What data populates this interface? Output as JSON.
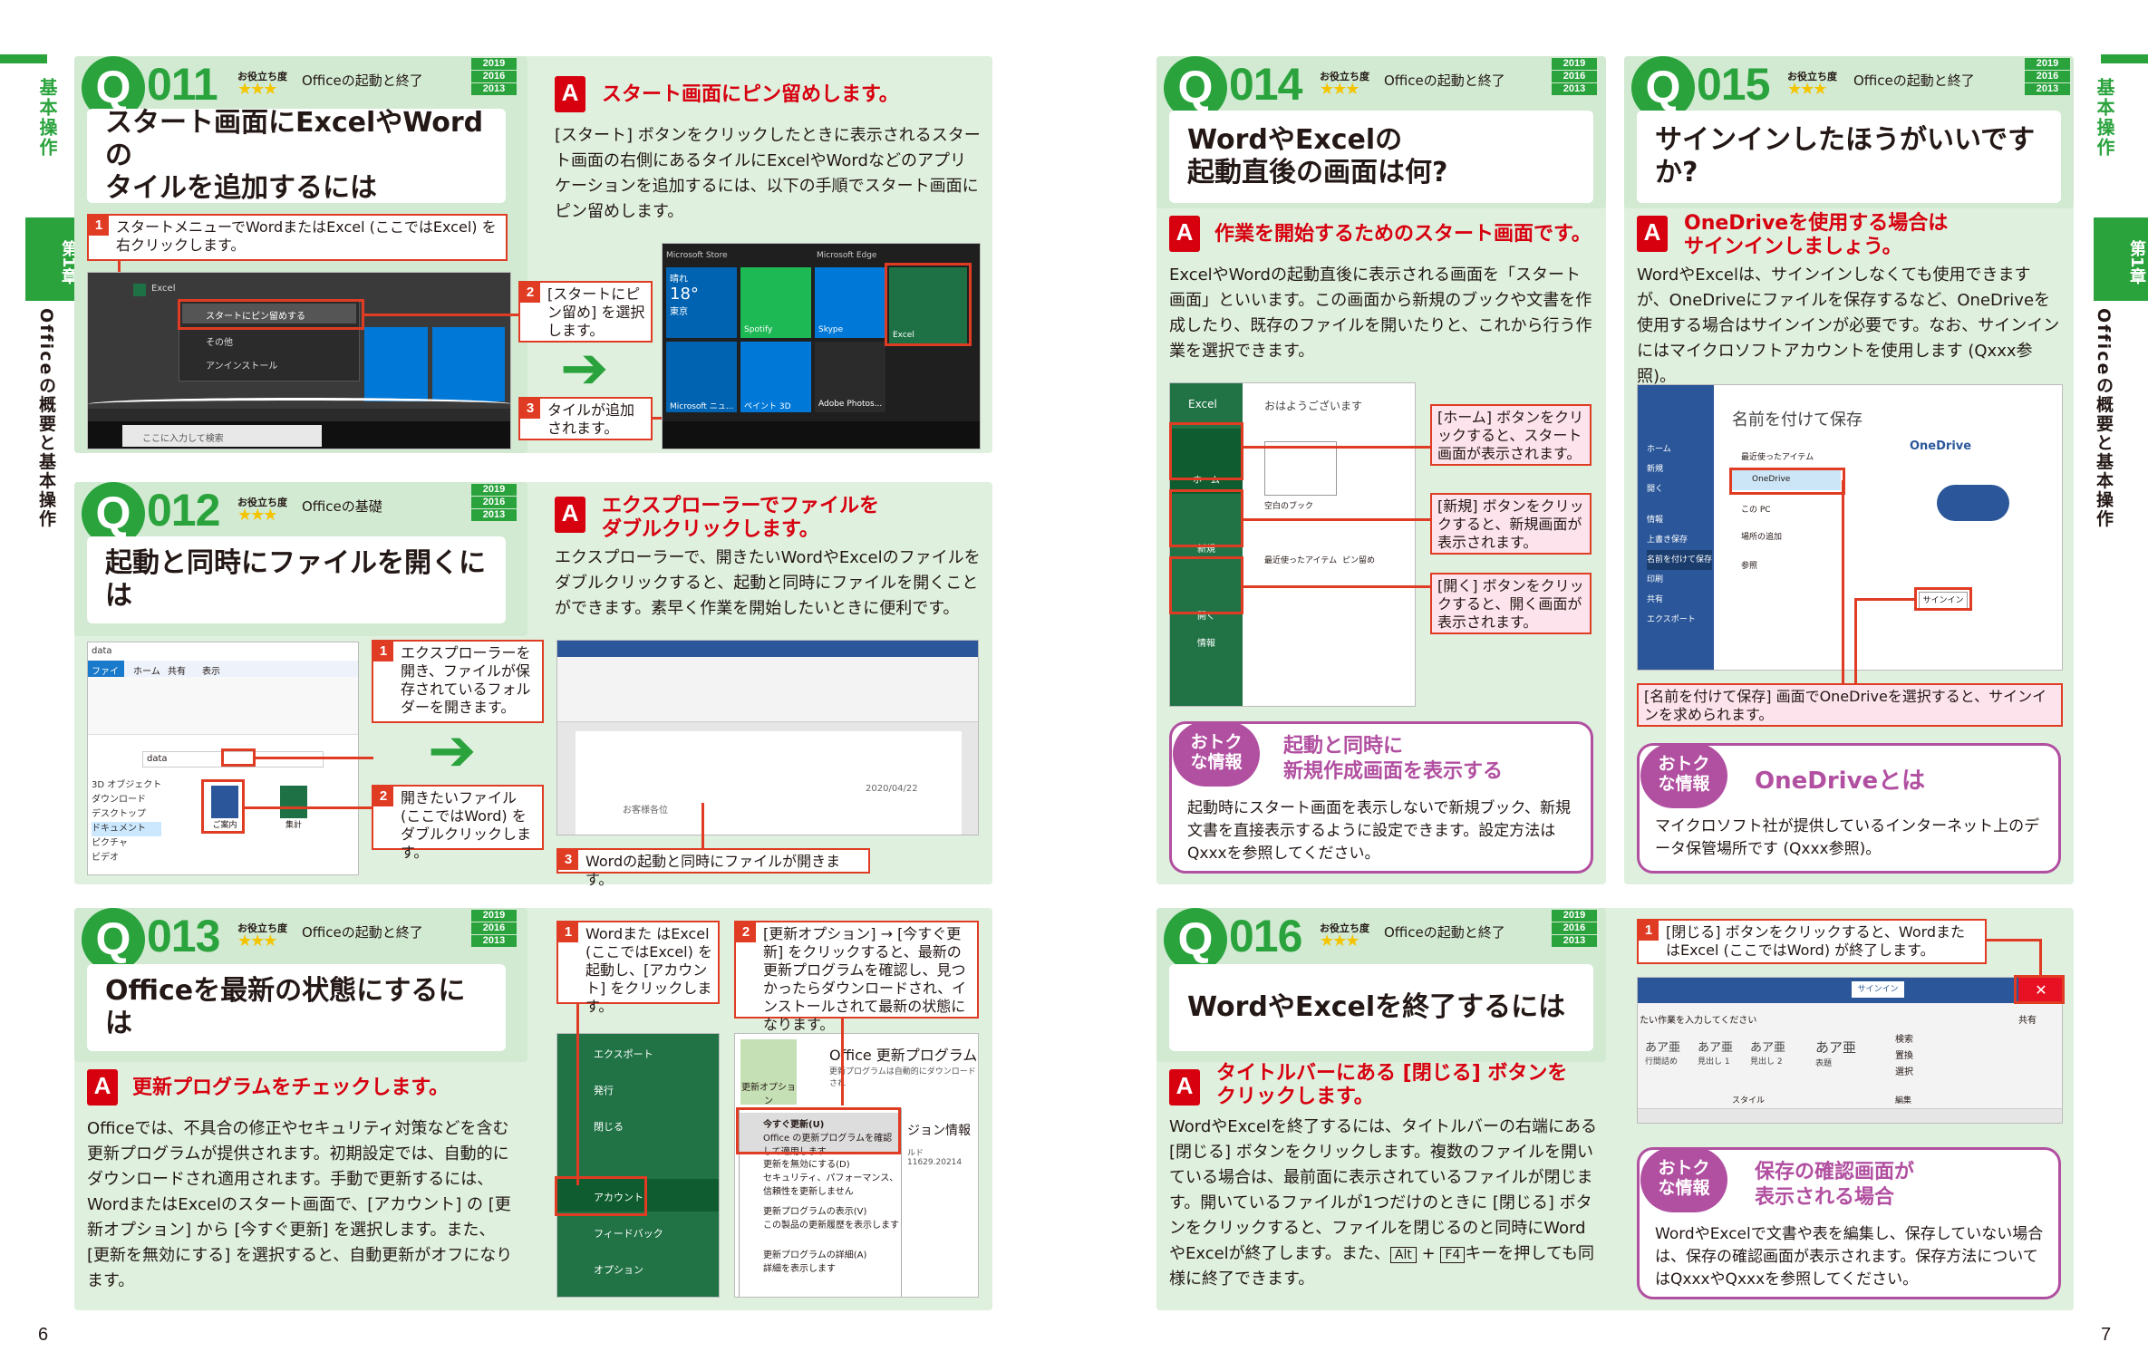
{
  "side": {
    "left_section": "基本操作",
    "left_chapter_label": "第1章",
    "left_chapter_title": "Officeの概要と基本操作",
    "right_section": "基本操作",
    "right_chapter_label": "第1章",
    "right_chapter_title": "Officeの概要と基本操作"
  },
  "page_numbers": {
    "left": "6",
    "right": "7"
  },
  "useful_label": "お役立ち度",
  "stars": "★★★",
  "versions": [
    "2019",
    "2016",
    "2013"
  ],
  "q011": {
    "num": "011",
    "category": "Officeの起動と終了",
    "title_l1": "スタート画面にExcelやWordの",
    "title_l2": "タイルを追加するには",
    "answer": "スタート画面にピン留めします。",
    "body": "[スタート] ボタンをクリックしたときに表示されるスタート画面の右側にあるタイルにExcelやWordなどのアプリケーションを追加するには、以下の手順でスタート画面にピン留めします。",
    "step1": "スタートメニューでWordまたはExcel (ここではExcel) を右クリックします。",
    "step2": "[スタートにピン留め] を選択します。",
    "step3": "タイルが追加されます。",
    "menu_pin": "スタートにピン留めする",
    "menu_other": "その他",
    "menu_uninstall": "アンインストール",
    "search_placeholder": "ここに入力して検索",
    "tile_store": "Microsoft Store",
    "tile_edge": "Microsoft Edge",
    "tile_weather": "晴れ",
    "tile_temp": "18°",
    "tile_city": "東京",
    "tile_spotify": "Spotify",
    "tile_skype": "Skype",
    "tile_excel": "Excel",
    "tile_news": "Microsoft ニュ...",
    "tile_paint": "ペイント 3D",
    "tile_adobe": "Adobe Photos..."
  },
  "q012": {
    "num": "012",
    "category": "Officeの基礎",
    "title": "起動と同時にファイルを開くには",
    "answer_l1": "エクスプローラーでファイルを",
    "answer_l2": "ダブルクリックします。",
    "body": "エクスプローラーで、開きたいWordやExcelのファイルをダブルクリックすると、起動と同時にファイルを開くことができます。素早く作業を開始したいときに便利です。",
    "step1": "エクスプローラーを開き、ファイルが保存されているフォルダーを開きます。",
    "step2": "開きたいファイル (ここではWord) をダブルクリックします。",
    "step3": "Wordの起動と同時にファイルが開きます。",
    "folder": "data",
    "tabs": [
      "ファイル",
      "ホーム",
      "共有",
      "表示"
    ],
    "nav": [
      "3D オブジェクト",
      "ダウンロード",
      "デスクトップ",
      "ドキュメント",
      "ピクチャ",
      "ビデオ"
    ],
    "file1": "ご案内",
    "file2": "集計",
    "doc_date": "2020/04/22",
    "doc_greeting": "お客様各位"
  },
  "q013": {
    "num": "013",
    "category": "Officeの起動と終了",
    "title": "Officeを最新の状態にするには",
    "answer": "更新プログラムをチェックします。",
    "body": "Officeでは、不具合の修正やセキュリティ対策などを含む更新プログラムが提供されます。初期設定では、自動的にダウンロードされ適用されます。手動で更新するには、WordまたはExcelのスタート画面で、[アカウント] の [更新オプション] から [今すぐ更新] を選択します。また、[更新を無効にする] を選択すると、自動更新がオフになります。",
    "step1": "Wordまた はExcel (ここではExcel) を起動し、[アカウント] をクリックします。",
    "step2": "[更新オプション] → [今すぐ更新] をクリックすると、最新の更新プログラムを確認し、見つかったらダウンロードされ、インストールされて最新の状態になります。",
    "menu": [
      "エクスポート",
      "発行",
      "閉じる",
      "アカウント",
      "フィードバック",
      "オプション"
    ],
    "update_title": "Office 更新プログラム",
    "update_desc": "更新プログラムは自動的にダウンロードされ",
    "update_btn": "更新オプション",
    "now": "今すぐ更新(U)",
    "now_desc": "Office の更新プログラムを確認して適用します",
    "disable": "更新を無効にする(D)",
    "disable_desc": "セキュリティ、パフォーマンス、信頼性を更新しません",
    "show": "更新プログラムの表示(V)",
    "show_desc": "この製品の更新履歴を表示します",
    "about": "更新プログラムの詳細(A)",
    "about_desc": "詳細を表示します",
    "version_info": "ジョン情報",
    "build": "ルド 11629.20214"
  },
  "q014": {
    "num": "014",
    "category": "Officeの起動と終了",
    "title_l1": "WordやExcelの",
    "title_l2": "起動直後の画面は何?",
    "answer": "作業を開始するためのスタート画面です。",
    "body": "ExcelやWordの起動直後に表示される画面を「スタート画面」といいます。この画面から新規のブックや文書を作成したり、既存のファイルを開いたりと、これから行う作業を選択できます。",
    "callout1": "[ホーム] ボタンをクリックすると、スタート画面が表示されます。",
    "callout2": "[新規] ボタンをクリックすると、新規画面が表示されます。",
    "callout3": "[開く] ボタンをクリックすると、開く画面が表示されます。",
    "app": "Excel",
    "greeting": "おはようございます",
    "nav_home": "ホーム",
    "nav_new": "新規",
    "nav_open": "開く",
    "nav_info": "情報",
    "blank": "空白のブック",
    "recent": "最近使ったアイテム",
    "pinned": "ピン留め",
    "otoku_badge_l1": "おトク",
    "otoku_badge_l2": "な情報",
    "otoku_title_l1": "起動と同時に",
    "otoku_title_l2": "新規作成画面を表示する",
    "otoku_body": "起動時にスタート画面を表示しないで新規ブック、新規文書を直接表示するように設定できます。設定方法はQxxxを参照してください。"
  },
  "q015": {
    "num": "015",
    "category": "Officeの起動と終了",
    "title": "サインインしたほうがいいですか?",
    "answer_l1": "OneDriveを使用する場合は",
    "answer_l2": "サインインしましょう。",
    "body": "WordやExcelは、サインインしなくても使用できますが、OneDriveにファイルを保存するなど、OneDriveを使用する場合はサインインが必要です。なお、サインインにはマイクロソフトアカウントを使用します (Qxxx参照)。",
    "caption": "[名前を付けて保存] 画面でOneDriveを選択すると、サインインを求められます。",
    "save_title": "名前を付けて保存",
    "onedrive": "OneDrive",
    "this_pc": "この PC",
    "add_place": "場所の追加",
    "browse": "参照",
    "recent": "最近使ったアイテム",
    "signin": "サインイン",
    "side": [
      "ホーム",
      "新規",
      "開く",
      "情報",
      "上書き保存",
      "名前を付けて保存",
      "印刷",
      "共有",
      "エクスポート"
    ],
    "otoku_badge_l1": "おトク",
    "otoku_badge_l2": "な情報",
    "otoku_title": "OneDriveとは",
    "otoku_body": "マイクロソフト社が提供しているインターネット上のデータ保管場所です (Qxxx参照)。"
  },
  "q016": {
    "num": "016",
    "category": "Officeの起動と終了",
    "title": "WordやExcelを終了するには",
    "answer_l1": "タイトルバーにある [閉じる] ボタンを",
    "answer_l2": "クリックします。",
    "body_pre": "WordやExcelを終了するには、タイトルバーの右端にある [閉じる] ボタンをクリックします。複数のファイルを開いている場合は、最前面に表示されているファイルが閉じます。開いているファイルが1つだけのときに [閉じる] ボタンをクリックすると、ファイルを閉じるのと同時にWordやExcelが終了します。また、",
    "key_alt": "Alt",
    "plus": "+",
    "key_f4": "F4",
    "body_post": "キーを押しても同様に終了できます。",
    "step1": "[閉じる] ボタンをクリックすると、WordまたはExcel (ここではWord) が終了します。",
    "signin_btn": "サインイン",
    "tell": "たい作業を入力してください",
    "share": "共有",
    "styles": [
      "あア亜",
      "あア亜",
      "あア亜"
    ],
    "style_names": [
      "行間詰め",
      "見出し 1",
      "見出し 2"
    ],
    "style_title": "表題",
    "find": "検索",
    "replace": "置換",
    "select": "選択",
    "style_group": "スタイル",
    "edit_group": "編集",
    "otoku_badge_l1": "おトク",
    "otoku_badge_l2": "な情報",
    "otoku_title_l1": "保存の確認画面が",
    "otoku_title_l2": "表示される場合",
    "otoku_body": "WordやExcelで文書や表を編集し、保存していない場合は、保存の確認画面が表示されます。保存方法についてはQxxxやQxxxを参照してください。"
  },
  "colors": {
    "green": "#2aa33d",
    "red": "#d7000f",
    "callout_red": "#e03c24",
    "purple": "#b14fa0",
    "card_bg": "#dff0df"
  }
}
